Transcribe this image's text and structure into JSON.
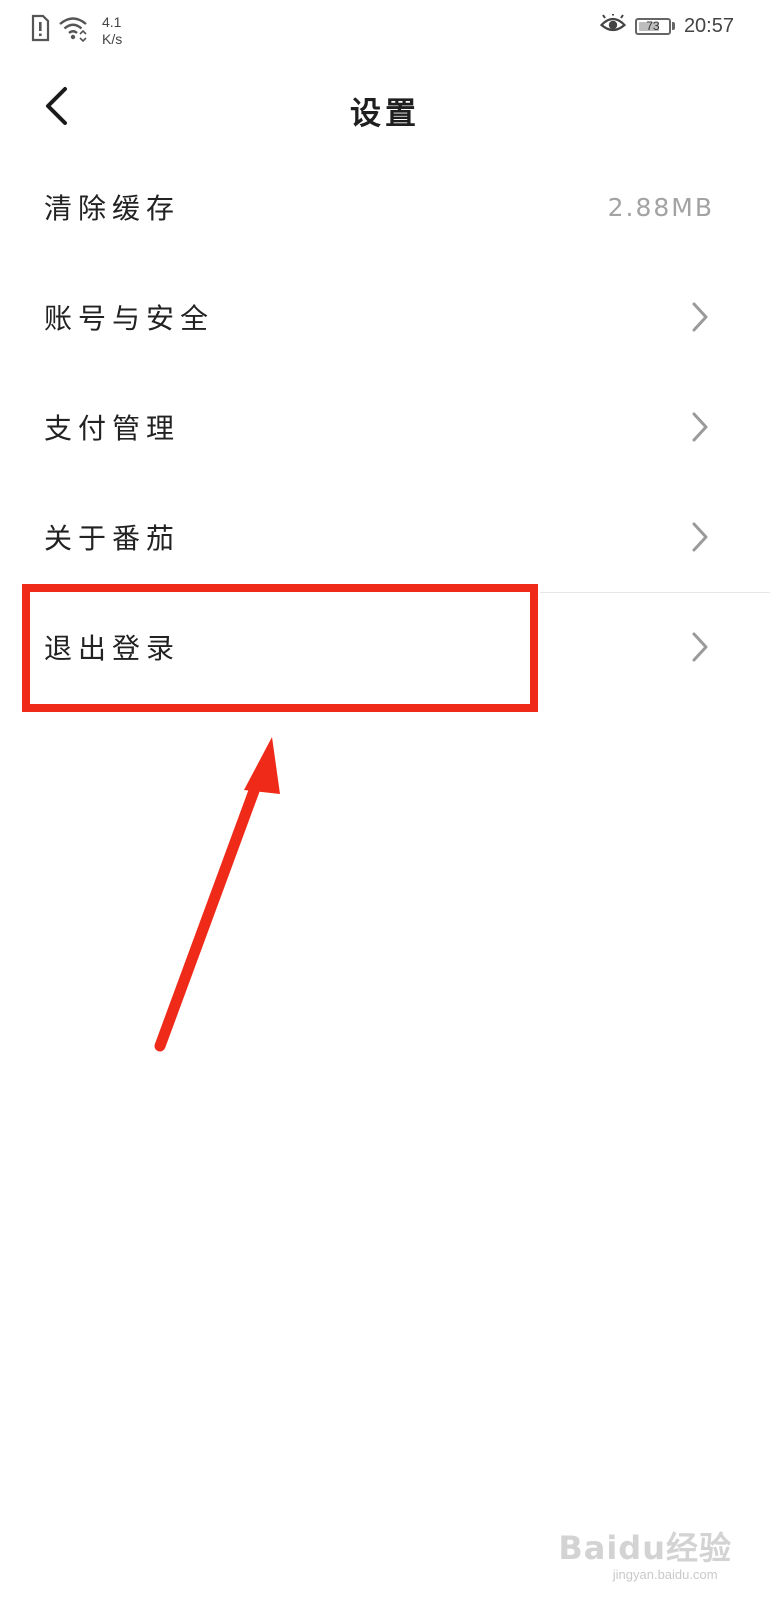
{
  "status_bar": {
    "net_speed_value": "4.1",
    "net_speed_unit": "K/s",
    "battery_level": "73",
    "time": "20:57",
    "icons": [
      "alert-icon",
      "wifi-icon",
      "eye-icon",
      "battery-icon"
    ]
  },
  "header": {
    "title": "设置",
    "back_icon": "chevron-left-icon"
  },
  "settings": {
    "items": [
      {
        "label": "清除缓存",
        "value": "2.88MB"
      },
      {
        "label": "账号与安全",
        "icon": "chevron-right-icon"
      },
      {
        "label": "支付管理",
        "icon": "chevron-right-icon"
      },
      {
        "label": "关于番茄",
        "icon": "chevron-right-icon"
      },
      {
        "label": "退出登录",
        "icon": "chevron-right-icon"
      }
    ]
  },
  "annotation": {
    "color": "#f02a18",
    "highlighted_item": "退出登录"
  },
  "watermark": {
    "brand": "Baidu经验",
    "url": "jingyan.baidu.com"
  }
}
